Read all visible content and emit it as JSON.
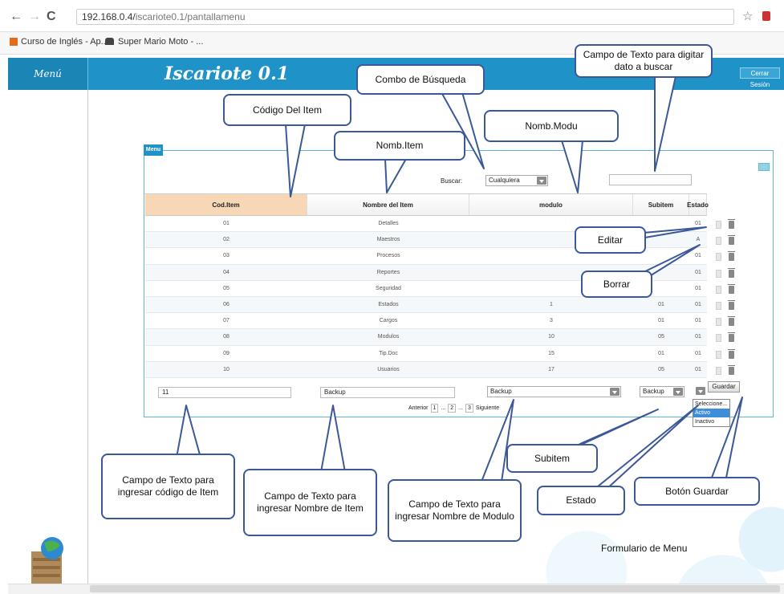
{
  "browser": {
    "url_host": "192.168.0.4/",
    "url_path": "iscariote0.1/pantallamenu",
    "bookmarks": [
      "Curso de Inglés - Ap...",
      "Super Mario Moto - ..."
    ]
  },
  "app": {
    "menu_label": "Menú",
    "title": "Iscariote 0.1",
    "logout_label": "Cerrar Sesión"
  },
  "panel": {
    "tab_label": "Menu",
    "search_label": "Buscar:",
    "search_combo_value": "Cualquiera",
    "search_text_value": ""
  },
  "table": {
    "headers": [
      "Cod.Item",
      "Nombre del Item",
      "modulo",
      "Subitem",
      "Estado"
    ],
    "rows": [
      [
        "01",
        "Detalles",
        "",
        "",
        "01"
      ],
      [
        "02",
        "Maestros",
        "",
        "",
        "A"
      ],
      [
        "03",
        "Procesos",
        "",
        "",
        "01"
      ],
      [
        "04",
        "Reportes",
        "",
        "",
        "01"
      ],
      [
        "05",
        "Seguridad",
        "",
        "",
        "01"
      ],
      [
        "06",
        "Estados",
        "1",
        "01",
        "01"
      ],
      [
        "07",
        "Cargos",
        "3",
        "01",
        "01"
      ],
      [
        "08",
        "Modulos",
        "10",
        "05",
        "01"
      ],
      [
        "09",
        "Tip.Doc",
        "15",
        "01",
        "01"
      ],
      [
        "10",
        "Usuarios",
        "17",
        "05",
        "01"
      ]
    ]
  },
  "form": {
    "code_value": "11",
    "name_value": "Backup",
    "module_value": "Backup",
    "subitem_value": "Backup",
    "save_label": "Guardar",
    "status_options": [
      "Seleccione...",
      "Activo",
      "Inactivo"
    ],
    "status_selected": "Activo",
    "pager": [
      "Anterior",
      "1",
      "...",
      "2",
      "...",
      "3",
      "Siguiente"
    ]
  },
  "callouts": {
    "codigo": "Código Del Item",
    "nomb_item": "Nomb.Item",
    "combo": "Combo de Búsqueda",
    "nomb_modu": "Nomb.Modu",
    "campo_buscar": "Campo de Texto para digitar dato a buscar",
    "editar": "Editar",
    "borrar": "Borrar",
    "campo_codigo": "Campo de Texto para ingresar código de Item",
    "campo_nombre": "Campo de Texto para ingresar Nombre de Item",
    "campo_modulo": "Campo de Texto para ingresar Nombre de Modulo",
    "subitem": "Subitem",
    "estado": "Estado",
    "guardar": "Botón Guardar"
  },
  "caption": "Formulario de Menu"
}
